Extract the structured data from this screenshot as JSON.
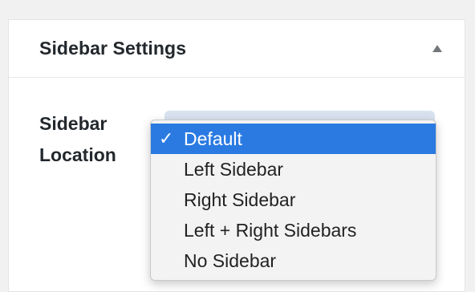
{
  "panel": {
    "title": "Sidebar Settings",
    "toggle_icon": "triangle-up-icon"
  },
  "field": {
    "label_line1": "Sidebar",
    "label_line2": "Location"
  },
  "dropdown": {
    "selected": "Default",
    "check_mark": "✓",
    "options": [
      "Default",
      "Left Sidebar",
      "Right Sidebar",
      "Left + Right Sidebars",
      "No Sidebar"
    ]
  },
  "colors": {
    "selected_bg": "#2a7ae2",
    "selected_text": "#ffffff",
    "text": "#23282d"
  }
}
